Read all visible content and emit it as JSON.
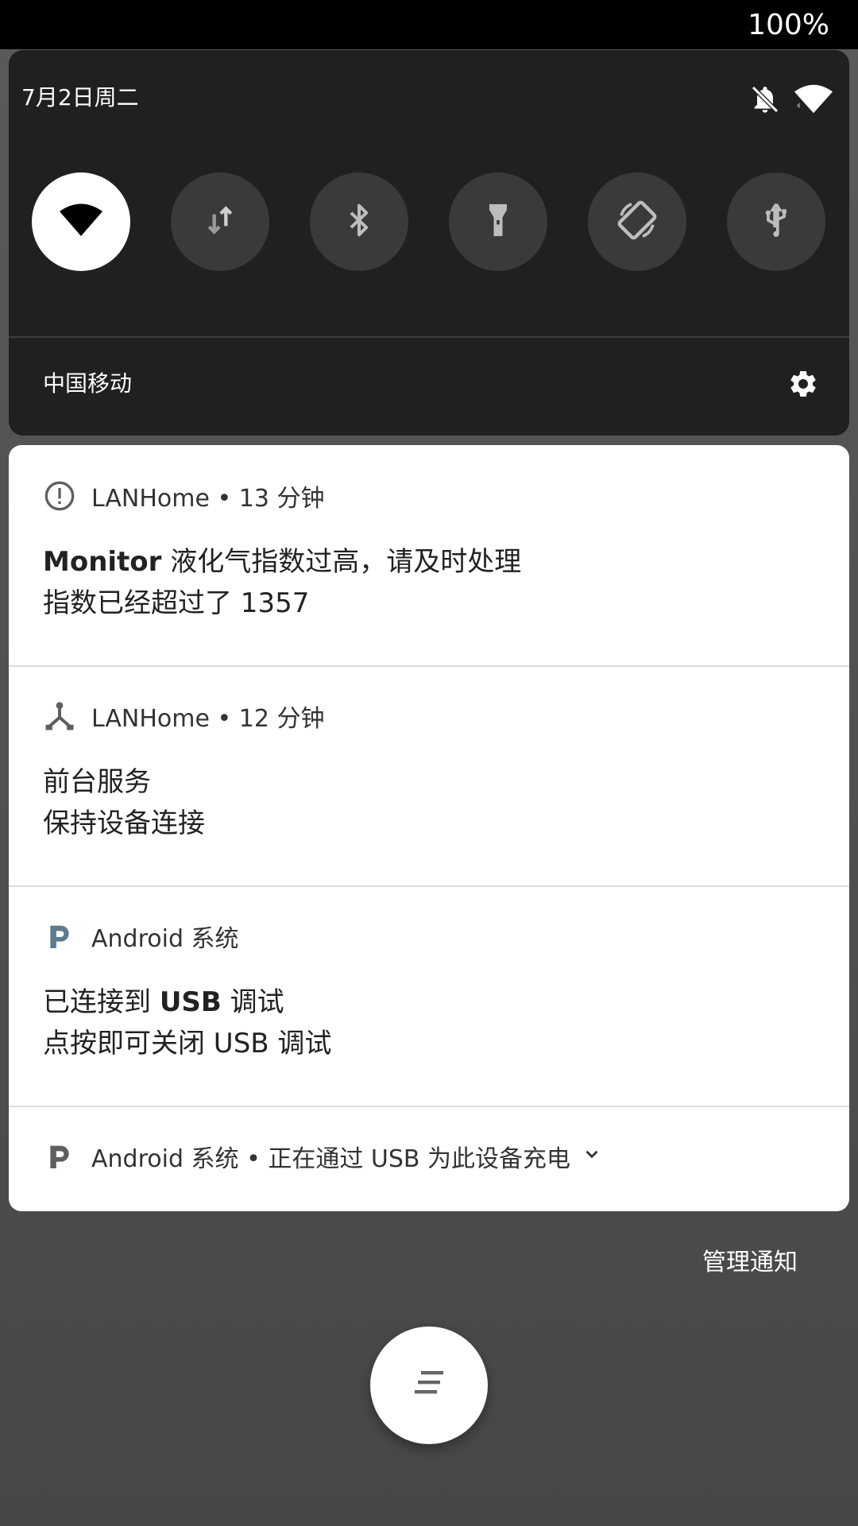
{
  "status_bar": {
    "battery": "100%"
  },
  "quick_settings": {
    "date": "7月2日周二",
    "tiles": [
      {
        "name": "wifi",
        "active": true
      },
      {
        "name": "mobile-data",
        "active": false
      },
      {
        "name": "bluetooth",
        "active": false
      },
      {
        "name": "flashlight",
        "active": false
      },
      {
        "name": "auto-rotate",
        "active": false
      },
      {
        "name": "usb",
        "active": false
      }
    ],
    "carrier": "中国移动"
  },
  "notifications": [
    {
      "icon": "alert-icon",
      "app": "LANHome",
      "separator": "•",
      "time": "13 分钟",
      "title_bold": "Monitor",
      "title_rest": " 液化气指数过高，请及时处理",
      "text": "指数已经超过了 1357"
    },
    {
      "icon": "network-icon",
      "app": "LANHome",
      "separator": "•",
      "time": "12 分钟",
      "title": "前台服务",
      "text": "保持设备连接"
    },
    {
      "icon": "android-system-icon",
      "app": "Android 系统",
      "title_pre": "已连接到 ",
      "title_bold": "USB",
      "title_post": " 调试",
      "text": "点按即可关闭 USB 调试"
    },
    {
      "icon": "android-system-icon",
      "app": "Android 系统",
      "separator": "•",
      "summary": "正在通过 USB 为此设备充电"
    }
  ],
  "manage_label": "管理通知",
  "colors": {
    "panel": "#202020",
    "tile_inactive": "#3a3a3a",
    "tile_active": "#ffffff",
    "android_icon": "#5f7a8a"
  }
}
